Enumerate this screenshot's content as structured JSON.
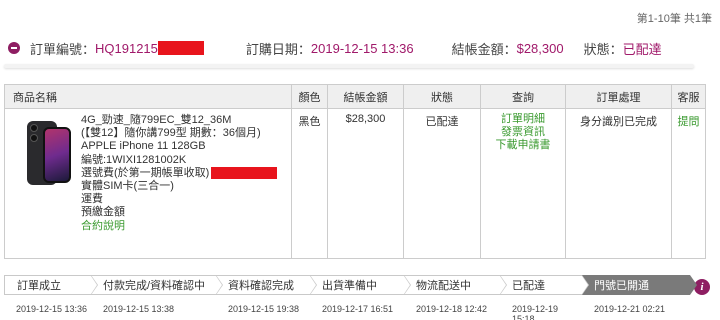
{
  "pagination": "第1-10筆 共1筆",
  "order": {
    "number_label": "訂單編號：",
    "number_value": "HQ191215",
    "date_label": "訂購日期：",
    "date_value": "2019-12-15 13:36",
    "total_label": "結帳金額：",
    "total_value": "$28,300",
    "status_label": "狀態：",
    "status_value": "已配達"
  },
  "table": {
    "headers": {
      "name": "商品名稱",
      "color": "顏色",
      "amount": "結帳金額",
      "status": "狀態",
      "query": "查詢",
      "process": "訂單處理",
      "service": "客服"
    },
    "row": {
      "product_lines": [
        "4G_勁速_隨799EC_雙12_36M",
        "(【雙12】隨你講799型 期數：36個月)",
        "APPLE iPhone 11 128GB",
        "編號:1WIXI1281002K",
        "選號費(於第一期帳單收取)",
        "實體SIM卡(三合一)",
        "運費",
        "預繳金額"
      ],
      "contract_link": "合約說明",
      "color": "黑色",
      "amount": "$28,300",
      "status": "已配達",
      "query_links": [
        "訂單明細",
        "發票資訊",
        "下載申請書"
      ],
      "process": "身分識別已完成",
      "service_link": "提問"
    }
  },
  "progress": {
    "steps": [
      {
        "label": "訂單成立",
        "date": "2019-12-15 13:36"
      },
      {
        "label": "付款完成/資料確認中",
        "date": "2019-12-15 13:38"
      },
      {
        "label": "資料確認完成",
        "date": "2019-12-15 19:38"
      },
      {
        "label": "出貨準備中",
        "date": "2019-12-17 16:51"
      },
      {
        "label": "物流配送中",
        "date": "2019-12-18 12:42"
      },
      {
        "label": "已配達",
        "date": "2019-12-19 15:18"
      },
      {
        "label": "門號已開通",
        "date": "2019-12-21 02:21"
      }
    ],
    "active_step": 6
  },
  "icons": {
    "collapse": "minus-circle-icon",
    "info": "info-icon",
    "product": "iphone-11-product-image"
  },
  "colors": {
    "accent": "#a0196a",
    "redaction": "#e8141c",
    "link_green": "#3a9a2f",
    "active_step": "#7a7a7a"
  }
}
